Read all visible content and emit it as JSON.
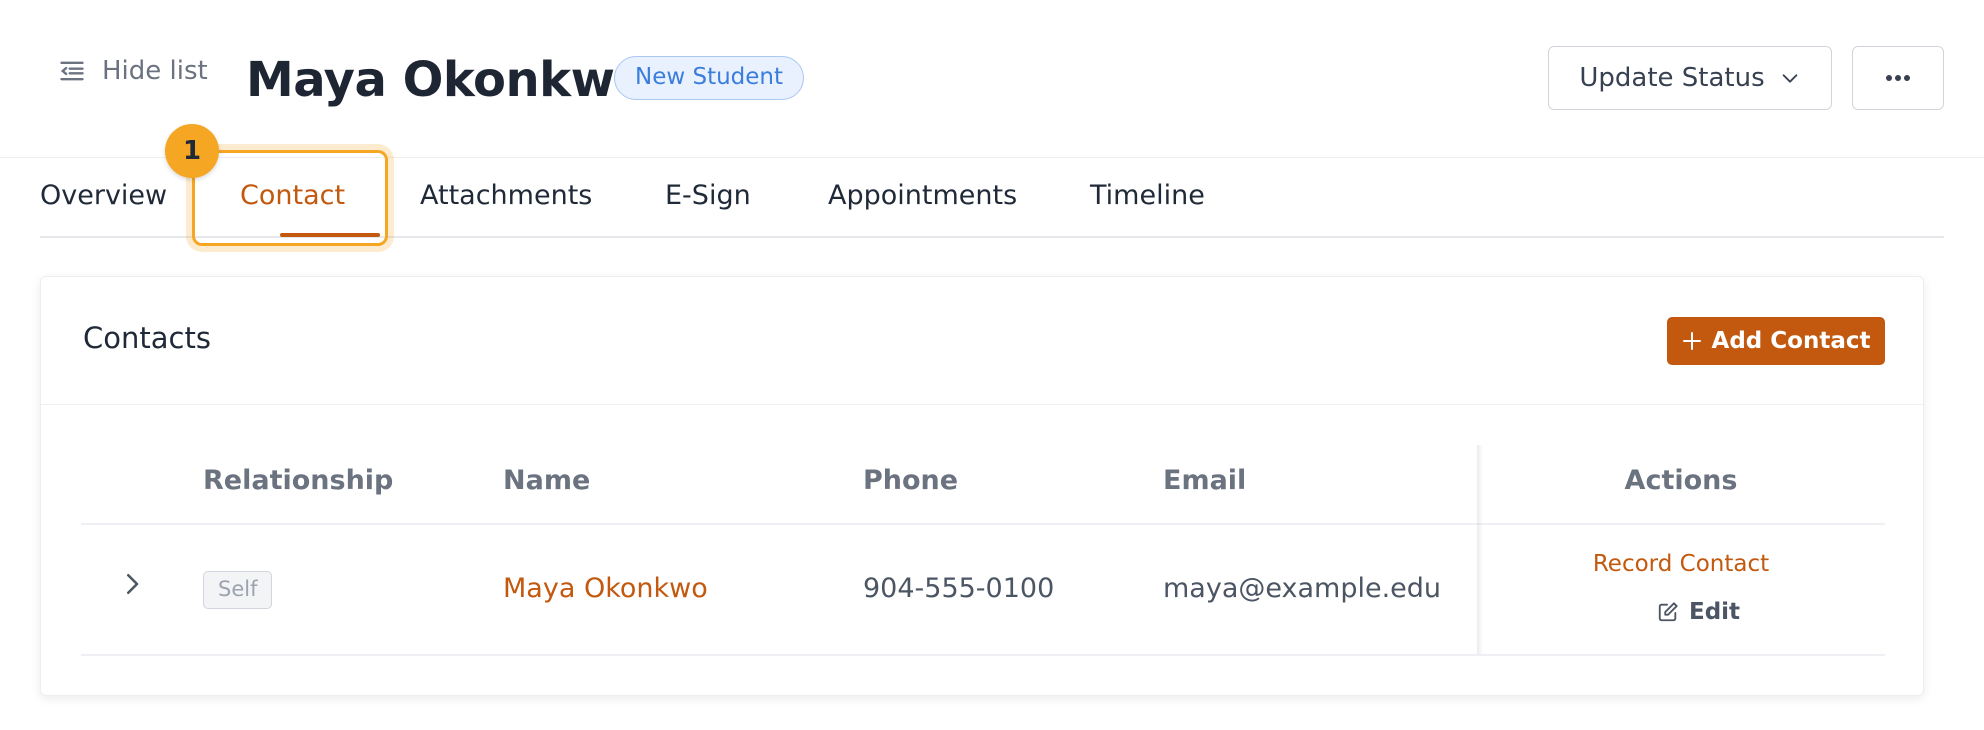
{
  "header": {
    "hide_list_label": "Hide list",
    "title": "Maya Okonkwo",
    "status_badge": "New Student",
    "update_status_label": "Update Status",
    "more_label": "•••"
  },
  "tabs": [
    {
      "label": "Overview",
      "active": false
    },
    {
      "label": "Contact",
      "active": true
    },
    {
      "label": "Attachments",
      "active": false
    },
    {
      "label": "E-Sign",
      "active": false
    },
    {
      "label": "Appointments",
      "active": false
    },
    {
      "label": "Timeline",
      "active": false
    }
  ],
  "step_marker": "1",
  "contacts": {
    "title": "Contacts",
    "add_button_label": "Add Contact",
    "columns": [
      "Relationship",
      "Name",
      "Phone",
      "Email",
      "Actions"
    ],
    "rows": [
      {
        "relationship": "Self",
        "name": "Maya Okonkwo",
        "phone": "904-555-0100",
        "email": "maya@example.edu",
        "action_primary": "Record Contact",
        "action_secondary": "Edit"
      }
    ]
  },
  "colors": {
    "accent": "#c2590f",
    "highlight": "#f5a623",
    "badge_blue": "#3b7ddd"
  }
}
